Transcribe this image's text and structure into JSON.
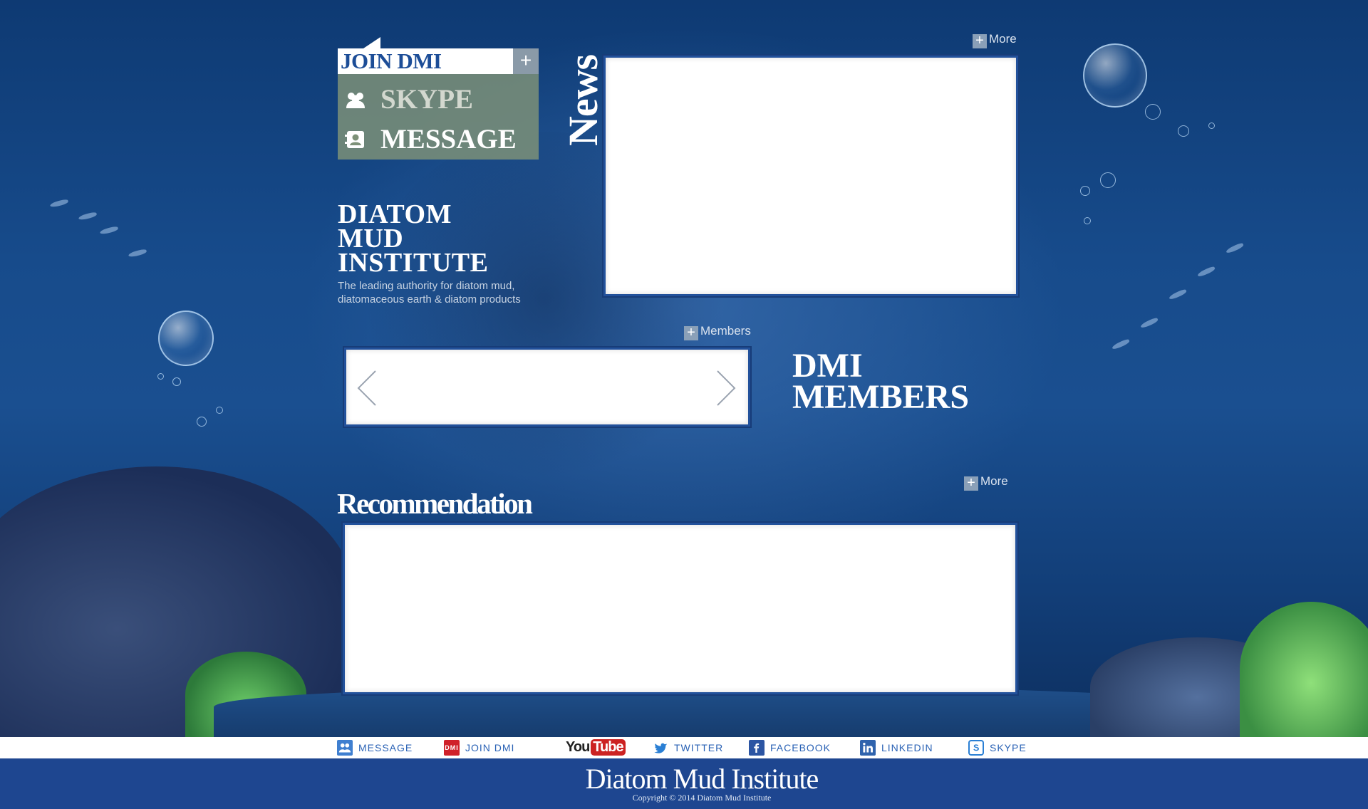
{
  "join_panel": {
    "header": "JOIN DMI",
    "expand_symbol": "+",
    "items": [
      {
        "label": "SKYPE",
        "icon": "group-icon"
      },
      {
        "label": "MESSAGE",
        "icon": "contact-card-icon"
      }
    ]
  },
  "institute": {
    "title_lines": [
      "DIATOM",
      "MUD",
      "INSTITUTE"
    ],
    "tagline": "The leading authority for diatom mud, diatomaceous earth & diatom products"
  },
  "news": {
    "title": "News",
    "more_label": "More",
    "more_symbol": "+"
  },
  "members": {
    "link_label": "Members",
    "link_symbol": "+",
    "title_lines": [
      "DMI",
      "MEMBERS"
    ],
    "prev_icon": "chevron-left-icon",
    "next_icon": "chevron-right-icon"
  },
  "recommendation": {
    "title": "Recommendation",
    "more_label": "More",
    "more_symbol": "+"
  },
  "bottom_nav": {
    "message": "MESSAGE",
    "join_dmi": "JOIN DMI",
    "join_dmi_badge": "DMI",
    "youtube_you": "You",
    "youtube_tube": "Tube",
    "twitter": "TWITTER",
    "facebook": "FACEBOOK",
    "linkedin": "LINKEDIN",
    "skype": "SKYPE"
  },
  "footer": {
    "title": "Diatom Mud Institute",
    "copyright": "Copyright © 2014 Diatom Mud Institute"
  },
  "colors": {
    "ocean": "#174b8b",
    "panel_border": "#22519b",
    "footer": "#1e4690",
    "nav_text": "#2a62b5",
    "join_panel": "#7d9178"
  }
}
